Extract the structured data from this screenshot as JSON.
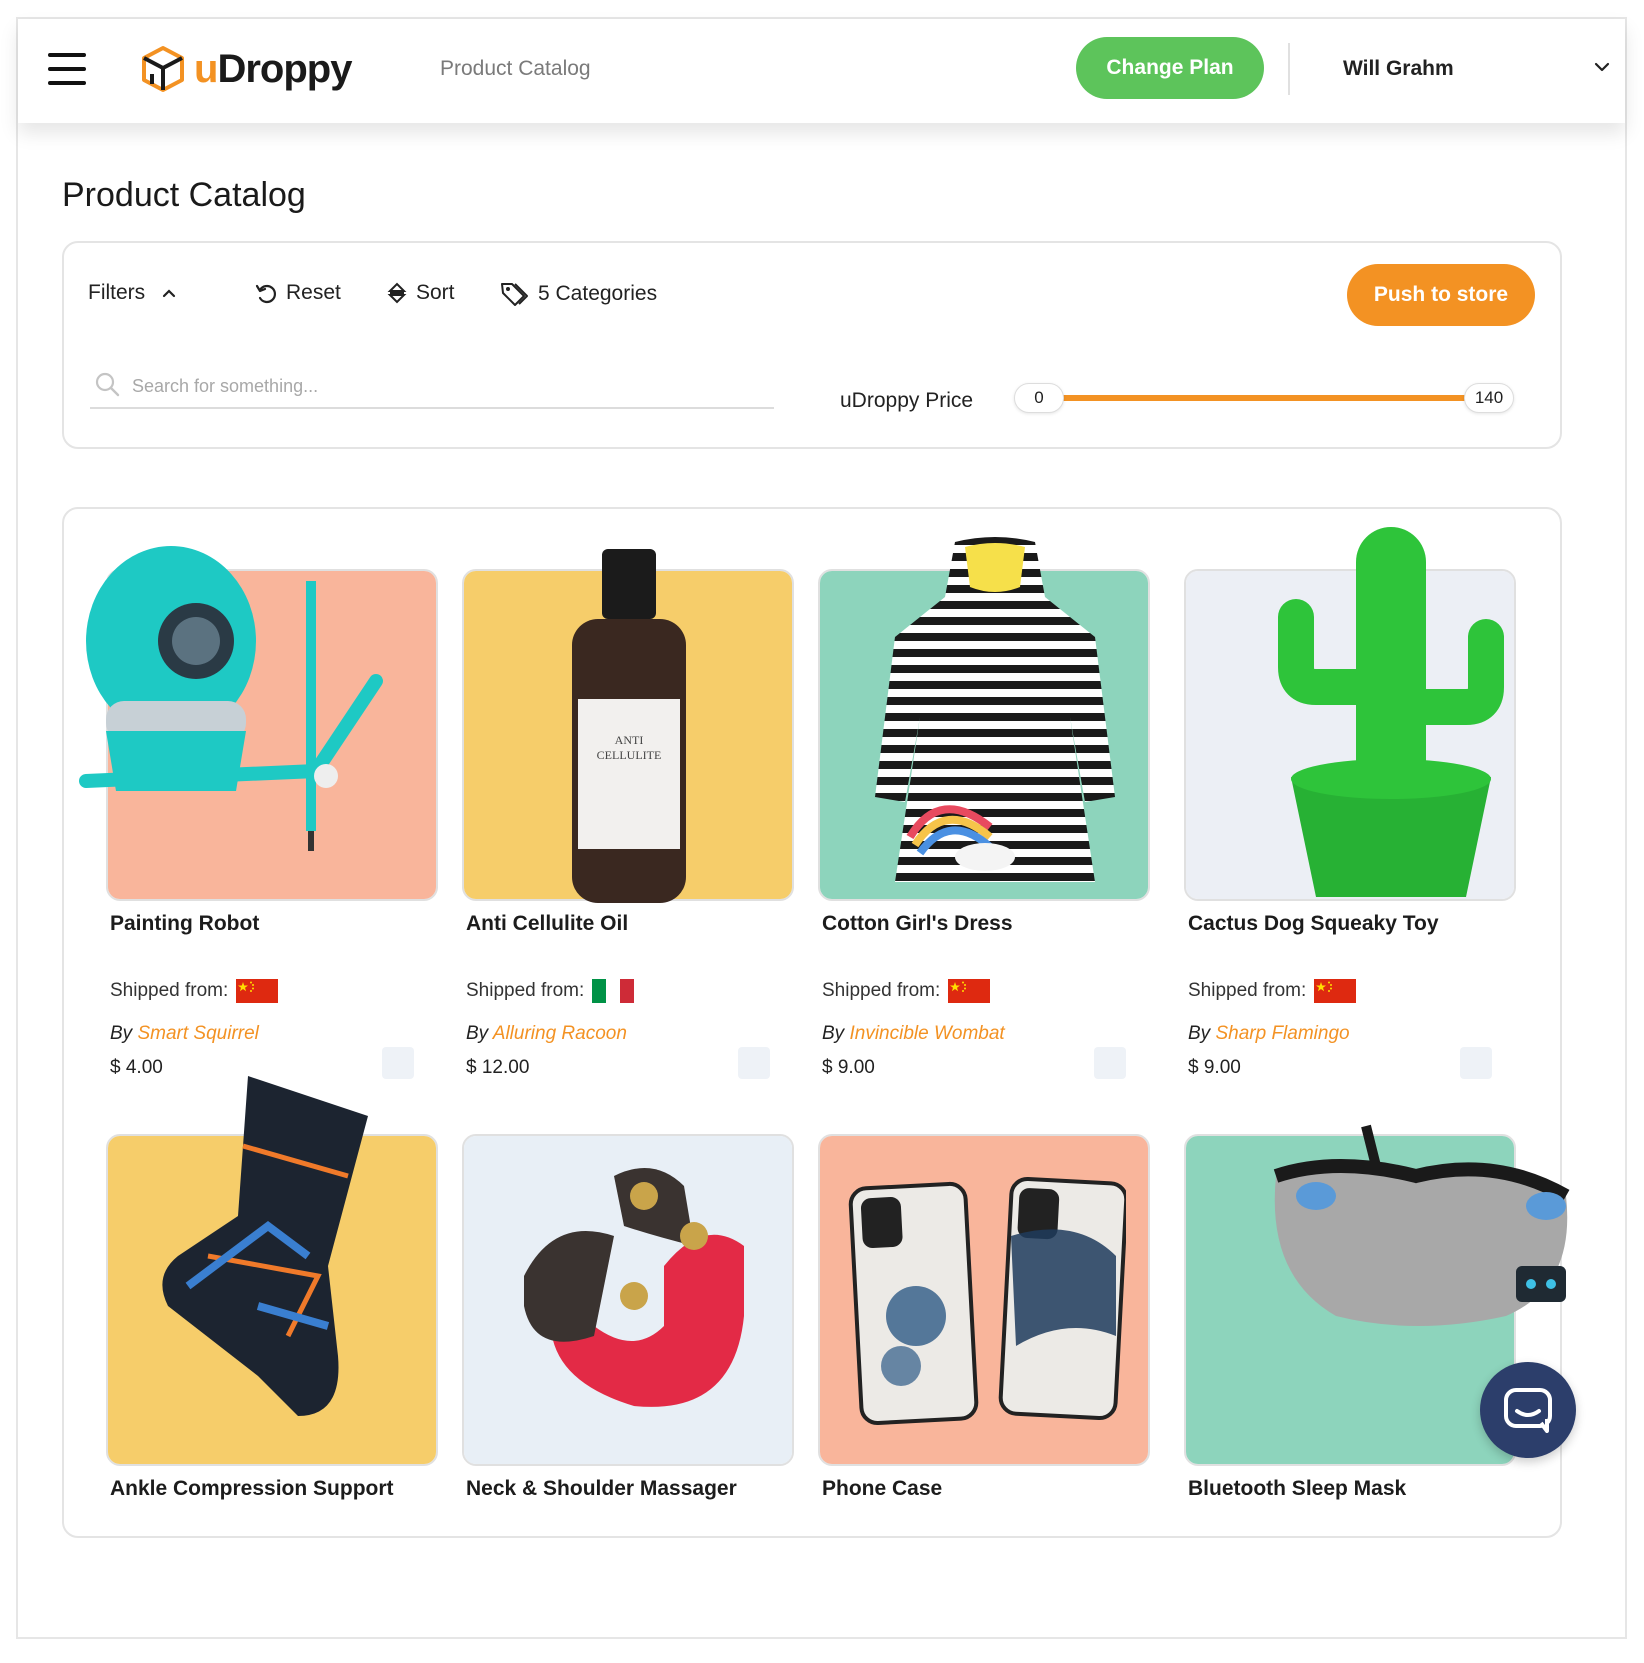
{
  "header": {
    "brand_prefix": "u",
    "brand_rest": "Droppy",
    "breadcrumb": "Product Catalog",
    "change_plan_label": "Change Plan",
    "user_name": "Will Grahm"
  },
  "page": {
    "title": "Product Catalog"
  },
  "filters": {
    "filters_label": "Filters",
    "reset_label": "Reset",
    "sort_label": "Sort",
    "categories_label": "5 Categories",
    "push_label": "Push to store",
    "search_placeholder": "Search for something...",
    "price_label": "uDroppy Price",
    "price_min": "0",
    "price_max": "140",
    "price_fill_fraction": 1.0
  },
  "products": [
    {
      "title": "Painting Robot",
      "ship_label": "Shipped from:",
      "ship_country": "China",
      "by_label": "By",
      "supplier": "Smart Squirrel",
      "price": "$ 4.00",
      "bg": "#f9b59b",
      "icon": "robot-icon"
    },
    {
      "title": "Anti Cellulite Oil",
      "ship_label": "Shipped from:",
      "ship_country": "Italy",
      "by_label": "By",
      "supplier": "Alluring Racoon",
      "price": "$ 12.00",
      "bg": "#f6cd6a",
      "icon": "bottle-icon"
    },
    {
      "title": "Cotton Girl's Dress",
      "ship_label": "Shipped from:",
      "ship_country": "China",
      "by_label": "By",
      "supplier": "Invincible Wombat",
      "price": "$ 9.00",
      "bg": "#8dd4bc",
      "icon": "dress-icon"
    },
    {
      "title": "Cactus Dog Squeaky Toy",
      "ship_label": "Shipped from:",
      "ship_country": "China",
      "by_label": "By",
      "supplier": "Sharp Flamingo",
      "price": "$ 9.00",
      "bg": "#eceff5",
      "icon": "cactus-icon"
    },
    {
      "title": "Ankle Compression Support",
      "bg": "#f6cd6a",
      "icon": "ankle-sleeve-icon"
    },
    {
      "title": "Neck & Shoulder Massager",
      "bg": "#e8eff6",
      "icon": "massager-icon"
    },
    {
      "title": "Phone Case",
      "bg": "#f9b59b",
      "icon": "phone-case-icon"
    },
    {
      "title": "Bluetooth Sleep Mask",
      "bg": "#8dd4bc",
      "icon": "sleep-mask-icon"
    }
  ],
  "colors": {
    "accent_orange": "#f39223",
    "accent_green": "#5dc45b",
    "chat_blue": "#2c3e6b"
  }
}
